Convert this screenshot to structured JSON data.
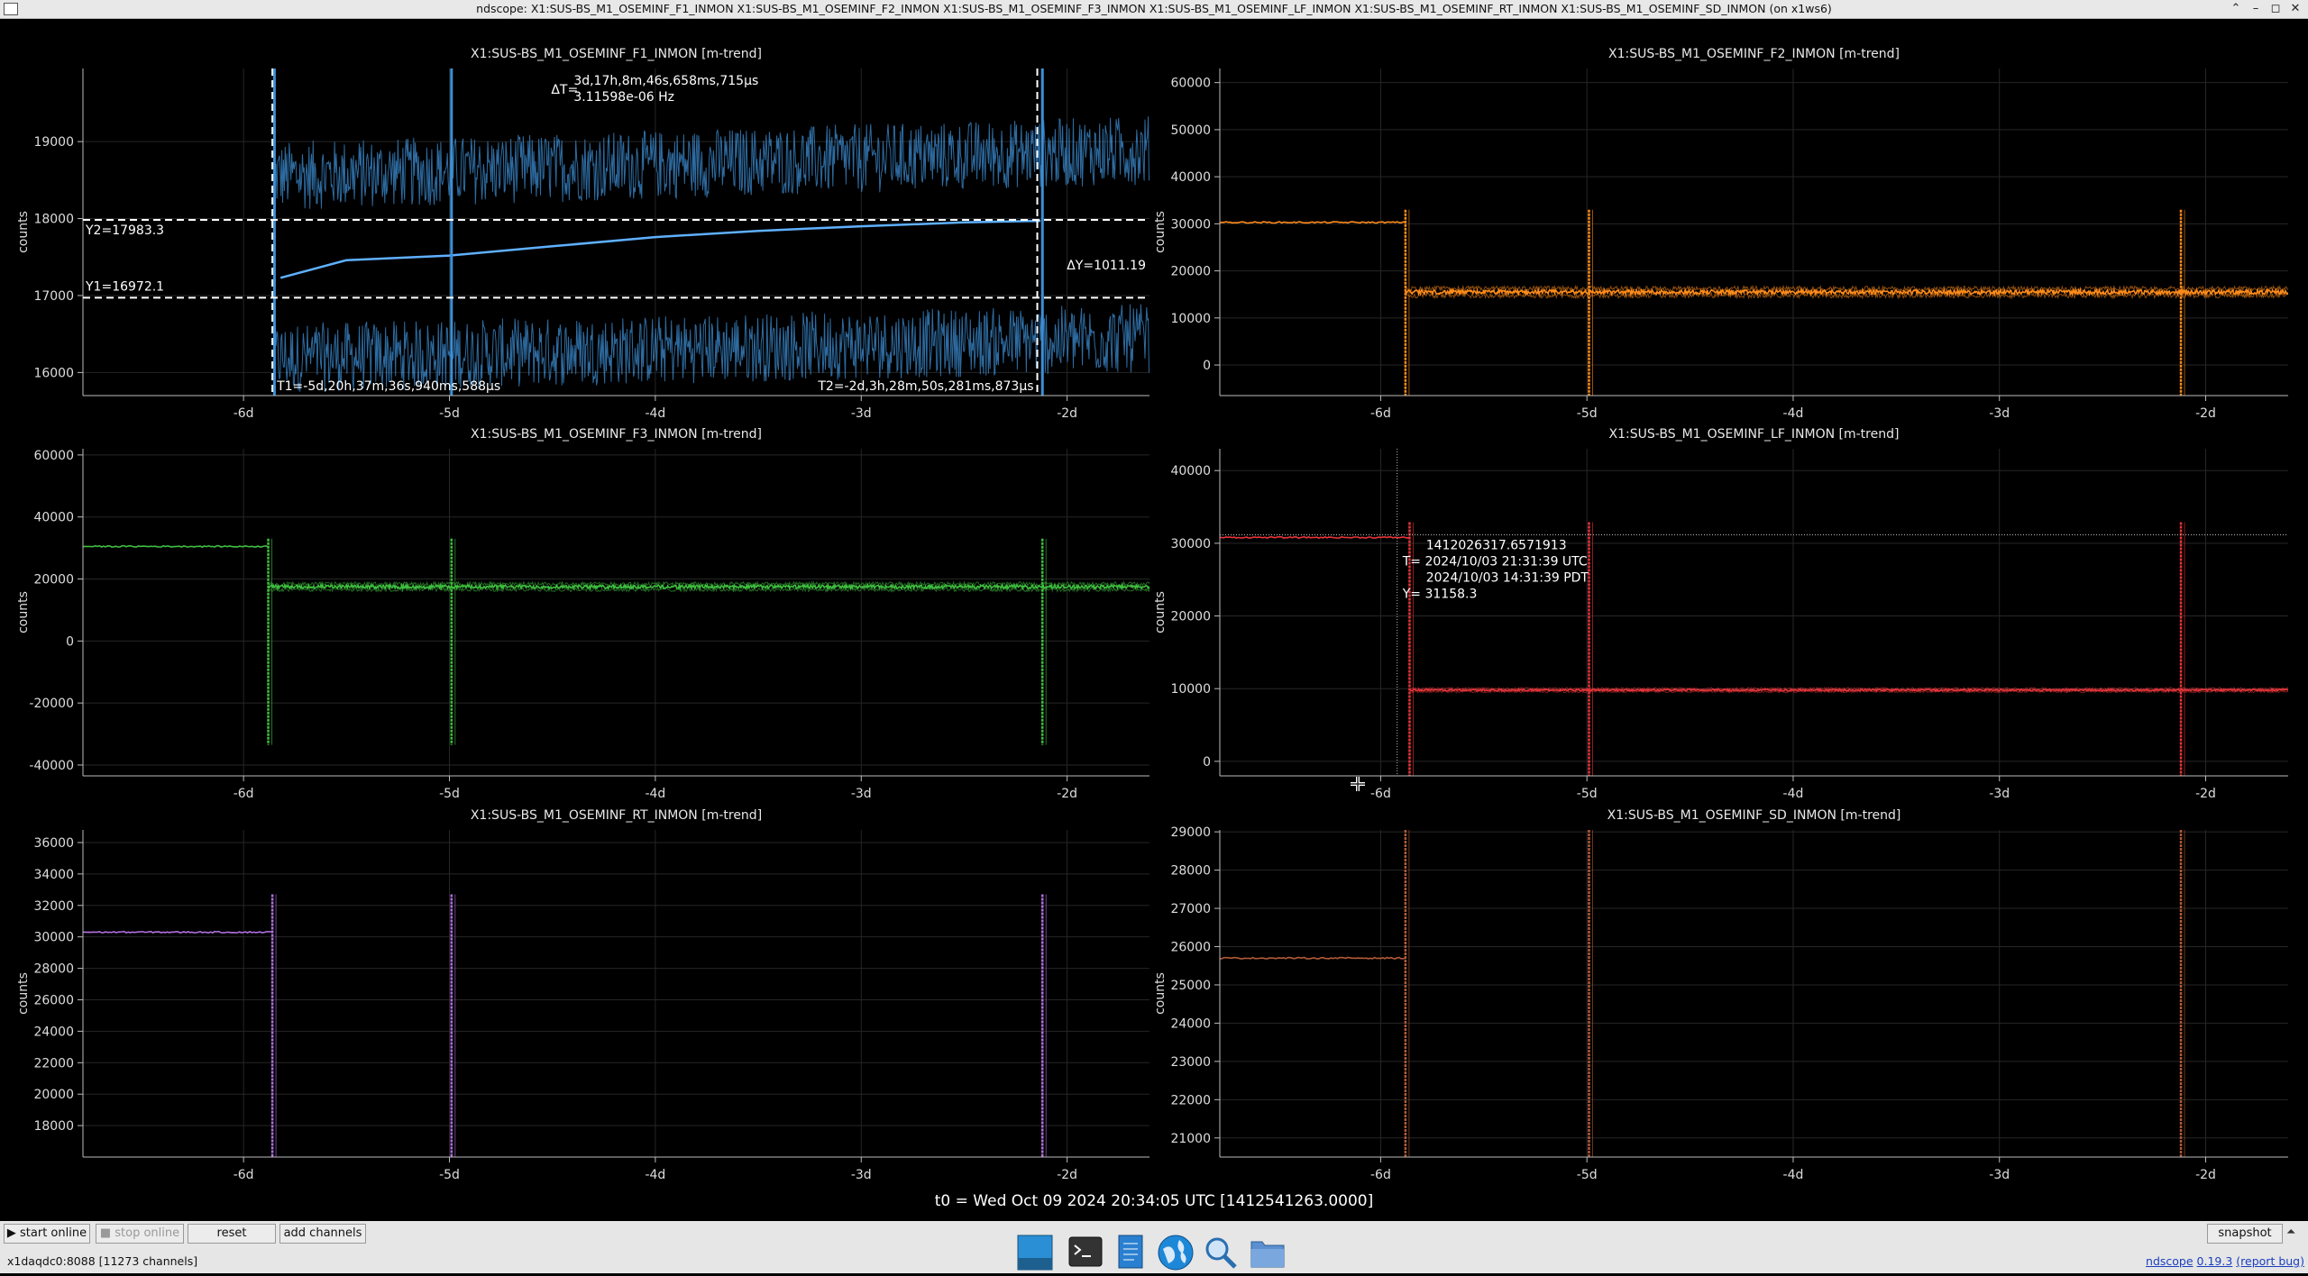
{
  "window": {
    "title": "ndscope: X1:SUS-BS_M1_OSEMINF_F1_INMON X1:SUS-BS_M1_OSEMINF_F2_INMON X1:SUS-BS_M1_OSEMINF_F3_INMON X1:SUS-BS_M1_OSEMINF_LF_INMON X1:SUS-BS_M1_OSEMINF_RT_INMON X1:SUS-BS_M1_OSEMINF_SD_INMON (on x1ws6)",
    "buttons": [
      "minimize",
      "maximize",
      "close"
    ]
  },
  "plots": [
    {
      "id": "F1",
      "title": "X1:SUS-BS_M1_OSEMINF_F1_INMON [m-trend]",
      "ylabel": "counts",
      "color": "#3d8fd6",
      "yticks": [
        16000,
        17000,
        18000,
        19000
      ],
      "ylim": [
        15700,
        19950
      ],
      "spikes": [
        -5.85,
        -4.99,
        -2.12
      ],
      "mean_before": [
        [
          -5.82,
          17230
        ],
        [
          -5.5,
          17460
        ],
        [
          -5.0,
          17520
        ],
        [
          -4.5,
          17640
        ],
        [
          -4.0,
          17760
        ],
        [
          -3.5,
          17840
        ],
        [
          -3.0,
          17900
        ],
        [
          -2.5,
          17950
        ],
        [
          -2.13,
          17970
        ]
      ],
      "envelope_upper": 18700,
      "envelope_lower": 16300,
      "cursors": {
        "T1": "T1=-5d,20h,37m,36s,940ms,588µs",
        "T2": "T2=-2d,3h,28m,50s,281ms,873µs",
        "dT_label": "ΔT=",
        "dT_value": "3d,17h,8m,46s,658ms,715µs",
        "dT_freq": "3.11598e-06 Hz",
        "Y1": "Y1=16972.1",
        "Y2": "Y2=17983.3",
        "dY": "ΔY=1011.19",
        "t1_days": -5.86,
        "t2_days": -2.145,
        "y1_value": 16972.1,
        "y2_value": 17983.3
      }
    },
    {
      "id": "F2",
      "title": "X1:SUS-BS_M1_OSEMINF_F2_INMON [m-trend]",
      "ylabel": "counts",
      "color": "#ff8c1a",
      "yticks": [
        0,
        10000,
        20000,
        30000,
        40000,
        50000,
        60000
      ],
      "ylim": [
        -6500,
        63000
      ],
      "before_level": 30300,
      "after_level": 15500,
      "band": 1800,
      "spikes": [
        -5.88,
        -4.99,
        -2.12
      ],
      "spike_min": -6500,
      "spike_max": 33000
    },
    {
      "id": "F3",
      "title": "X1:SUS-BS_M1_OSEMINF_F3_INMON [m-trend]",
      "ylabel": "counts",
      "color": "#3fbf3f",
      "yticks": [
        -40000,
        -20000,
        0,
        20000,
        40000,
        60000
      ],
      "ylim": [
        -43500,
        62000
      ],
      "before_level": 30500,
      "after_level": 17500,
      "band": 2200,
      "spikes": [
        -5.88,
        -4.99,
        -2.12
      ],
      "spike_min": -33500,
      "spike_max": 33000
    },
    {
      "id": "LF",
      "title": "X1:SUS-BS_M1_OSEMINF_LF_INMON [m-trend]",
      "ylabel": "counts",
      "color": "#e8353a",
      "yticks": [
        0,
        10000,
        20000,
        30000,
        40000
      ],
      "ylim": [
        -2000,
        43000
      ],
      "before_level": 30800,
      "after_level": 9800,
      "band": 500,
      "spikes": [
        -5.86,
        -4.99,
        -2.12
      ],
      "spike_min": -2000,
      "spike_max": 32900,
      "crosshair": {
        "x_days": -5.92,
        "y_value": 31158.3,
        "lines": [
          "1412026317.6571913",
          "T= 2024/10/03 21:31:39 UTC",
          "2024/10/03 14:31:39 PDT",
          "Y= 31158.3"
        ]
      }
    },
    {
      "id": "RT",
      "title": "X1:SUS-BS_M1_OSEMINF_RT_INMON [m-trend]",
      "ylabel": "counts",
      "color": "#b270e0",
      "yticks": [
        18000,
        20000,
        22000,
        24000,
        26000,
        28000,
        30000,
        32000,
        34000,
        36000
      ],
      "ylim": [
        16000,
        36800
      ],
      "before_level": 30300,
      "spikes": [
        -5.86,
        -4.99,
        -2.12
      ],
      "spike_min": 16000,
      "spike_max": 32700
    },
    {
      "id": "SD",
      "title": "X1:SUS-BS_M1_OSEMINF_SD_INMON [m-trend]",
      "ylabel": "counts",
      "color": "#b25a36",
      "yticks": [
        21000,
        22000,
        23000,
        24000,
        25000,
        26000,
        27000,
        28000,
        29000
      ],
      "ylim": [
        20500,
        29050
      ],
      "before_level": 25700,
      "spikes": [
        -5.88,
        -4.99,
        -2.12
      ],
      "spike_min": 20500,
      "spike_max": 29050
    }
  ],
  "x_axis": {
    "ticks": [
      "-6d",
      "-5d",
      "-4d",
      "-3d",
      "-2d"
    ],
    "tick_values": [
      -6,
      -5,
      -4,
      -3,
      -2
    ],
    "xlim": [
      -6.78,
      -1.6
    ]
  },
  "t0": "t0 = Wed Oct 09 2024 20:34:05 UTC [1412541263.0000]",
  "controls": {
    "start_online": "▶ start online",
    "stop_online": "■ stop online",
    "reset": "reset",
    "add_channels": "add channels",
    "snapshot": "snapshot",
    "up_arrow": "⏶"
  },
  "status": "x1daqdc0:8088  [11273 channels]",
  "version": {
    "app": "ndscope",
    "number": "0.19.3",
    "report": "(report bug)"
  },
  "taskbar": [
    "desktop-icon",
    "terminal-icon",
    "text-editor-icon",
    "browser-icon",
    "search-icon",
    "file-manager-icon"
  ]
}
